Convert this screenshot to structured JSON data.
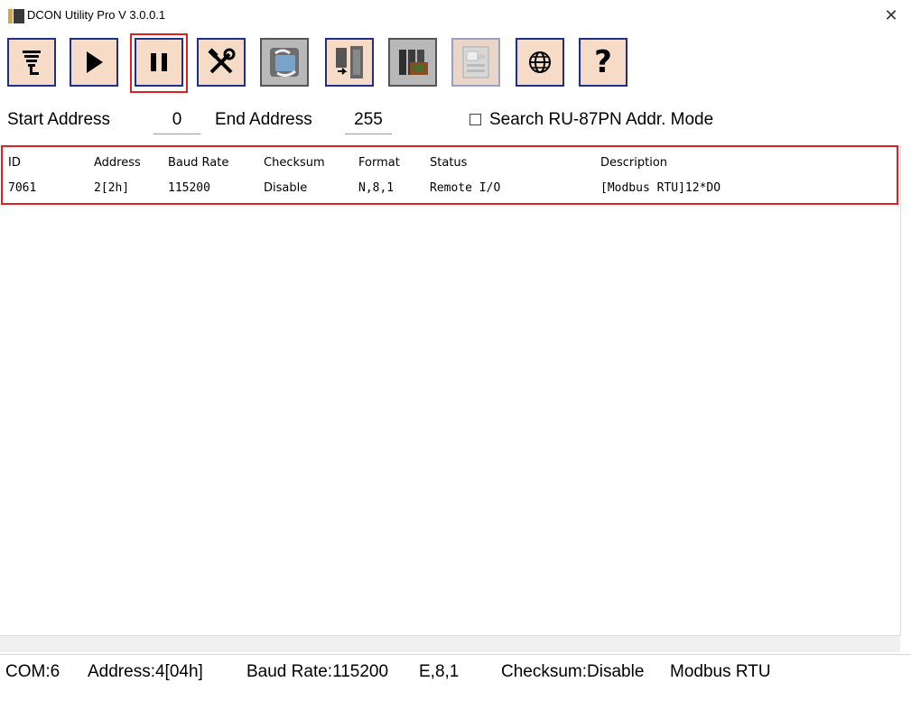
{
  "window": {
    "title": "DCON Utility Pro V 3.0.0.1",
    "close_glyph": "✕"
  },
  "toolbar": {
    "buttons": [
      {
        "name": "com-port-icon"
      },
      {
        "name": "search-icon"
      },
      {
        "name": "pause-icon"
      },
      {
        "name": "tools-icon"
      },
      {
        "name": "module-config-icon"
      },
      {
        "name": "io-module-icon"
      },
      {
        "name": "controller-icon"
      },
      {
        "name": "disabled-module-icon"
      },
      {
        "name": "globe-icon"
      },
      {
        "name": "help-icon"
      }
    ],
    "help_glyph": "?"
  },
  "search": {
    "start_label": "Start Address",
    "start_value": "0",
    "end_label": "End Address",
    "end_value": "255",
    "mode_label": "Search RU-87PN Addr. Mode",
    "mode_checked": false
  },
  "table": {
    "columns": [
      "ID",
      "Address",
      "Baud Rate",
      "Checksum",
      "Format",
      "Status",
      "Description"
    ],
    "rows": [
      [
        "7061",
        "2[2h]",
        "115200",
        "Disable",
        "N,8,1",
        "Remote I/O",
        "[Modbus RTU]12*DO"
      ]
    ]
  },
  "statusbar": {
    "com": "COM:6",
    "address": "Address:4[04h]",
    "baud": "Baud Rate:115200",
    "format": "E,8,1",
    "checksum": "Checksum:Disable",
    "protocol": "Modbus RTU"
  },
  "colors": {
    "button_face": "#f6dcc7",
    "button_border": "#1e2f8a",
    "highlight": "#e02020"
  }
}
